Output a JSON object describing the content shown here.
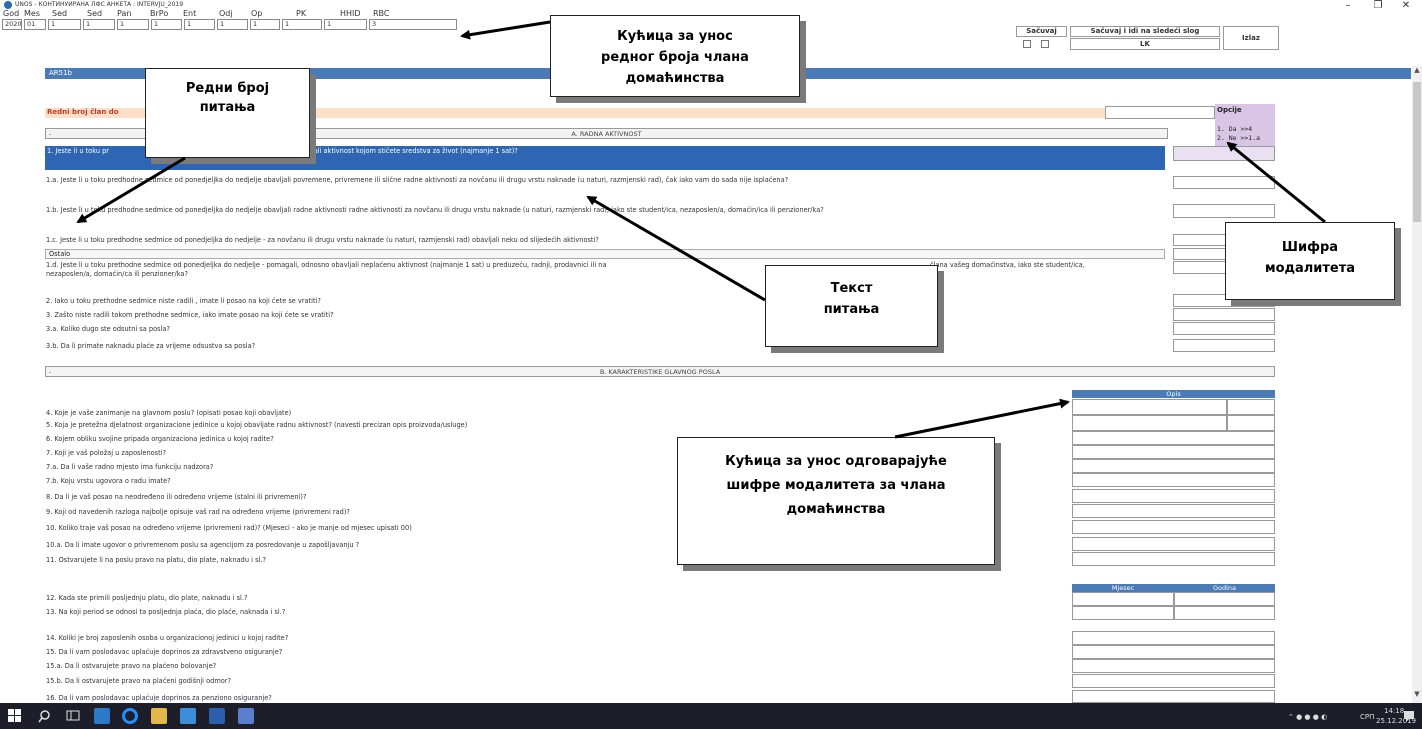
{
  "window": {
    "title": "UNOS - КОНТИНУИРАНА ЛФС АНКЕТА : INTERVJU_2019",
    "minimize": "–",
    "maximize": "❐",
    "close": "✕"
  },
  "header": {
    "labels": [
      "God",
      "Mes",
      "Sed",
      "Sed",
      "Pan",
      "BrPo",
      "Ent",
      "Odj",
      "Op",
      "PK",
      "HHID",
      "RBC"
    ],
    "values": [
      "2020",
      "01",
      "1",
      "1",
      "1",
      "1",
      "1",
      "1",
      "1",
      "1",
      "1",
      "3"
    ],
    "save_label": "Sačuvaj",
    "save_next_label": "Sačuvaj i idi na sledeći slog",
    "lk_label": "LK",
    "exit_label": "Izlaz"
  },
  "form": {
    "module_code": "AR51b",
    "member_row_label": "Redni broj član do",
    "options_title": "Opcije",
    "option_1": "1. Da >>4",
    "option_2": "2. Ne >>1.a",
    "section_a_marker": ".",
    "section_a_title": "A. RADNA AKTIVNOST",
    "q1": "1. Jeste li u toku pr",
    "q1_tail": "dili, obavljali aktivnost kojom stičete sredstva za život (najmanje 1 sat)?",
    "q1a": "1.a. Jeste li u toku predhodne sedmice od ponedjeljka do nedjelje obavljali povremene, privremene ili slične radne aktivnosti za novčanu ili drugu vrstu naknade (u naturi, razmjenski rad), čak iako vam do sada nije isplaćena?",
    "q1b": "1.b. Jeste li u toku predhodne sedmice od ponedjeljka do nedjelje obavljali radne aktivnosti radne aktivnosti za novčanu ili drugu vrstu naknade (u naturi, razmjenski rad), iako ste student/ica, nezaposlen/a, domaćin/ica ili penzioner/ka?",
    "q1c": "1.c. Jeste li u toku predhodne sedmice od ponedjeljka do nedjelje - za novčanu ili drugu vrstu naknade (u naturi, razmjenski rad) obavljali neku od slijedećih aktivnosti?",
    "q1c_value": "Ostalo",
    "q1d": "1.d. Jeste li u toku prethodne sedmice od ponedjeljka do nedjelje - pomagali, odnosno obavljali neplaćenu aktivnost (najmanje 1 sat) u preduzeću, radnji, prodavnici ili na",
    "q1d_tail": "člana vašeg domaćinstva, iako ste student/ica,",
    "q1d_line2": "nezaposlen/a, domaćin/ca ili penzioner/ka?",
    "q2": "2. Iako u toku prethodne sedmice niste radili , imate li posao na koji ćete se vratiti?",
    "q3": "3. Zašto niste radili tokom prethodne sedmice, iako imate posao na koji ćete se vratiti?",
    "q3a": "3.a. Koliko dugo ste odsutni sa posla?",
    "q3b": "3.b. Da li primate naknadu plaće za vrijeme odsustva sa posla?",
    "section_b_marker": ".",
    "section_b_title": "B. KARAKTERISTIKE GLAVNOG POSLA",
    "opis_header": "Opis",
    "q4": "4. Koje je vaše zanimanje na glavnom poslu? (opisati posao koji obavljate)",
    "q5": "5. Koja je pretežna djelatnost organizacione jedinice u kojoj obavljate radnu aktivnost? (navesti precizan opis proizvoda/usluge)",
    "q6": "6. Kojem obliku svojine pripada organizaciona jedinica u kojoj radite?",
    "q7": "7. Koji je vaš položaj u zaposlenosti?",
    "q7a": "7.a. Da li vaše radno mjesto ima funkciju nadzora?",
    "q7b": "7.b. Koju vrstu ugovora o radu imate?",
    "q8": "8. Da li je vaš posao  na neodređeno ili određeno vrijeme (stalni ili privremeni)?",
    "q9": "9. Koji od navedenih razloga najbolje opisuje vaš rad na određeno vrijeme (privremeni rad)?",
    "q10": "10. Koliko traje vaš posao na određeno vrijeme (privremeni rad)? (Mjeseci - ako je manje od mjesec upisati 00)",
    "q10a": "10.a. Da li imate ugovor o privremenom poslu sa agencijom za posredovanje u zapošljavanju ?",
    "q11": "11. Ostvarujete li na poslu pravo na platu, dio plate, naknadu i sl.?",
    "mjesec_header": "Mjesec",
    "godina_header": "Godina",
    "q12": "12. Kada ste primili posljednju platu, dio plate, naknadu i sl.?",
    "q13": "13. Na koji period se odnosi ta posljednja plaća, dio plaće, naknada i sl.?",
    "q14": "14. Koliki je broj zaposlenih osoba u organizacionoj jedinici u kojoj radite?",
    "q15": "15. Da li vam poslodavac uplaćuje doprinos za zdravstveno osiguranje?",
    "q15a": "15.a. Da li ostvarujete pravo na plaćeno bolovanje?",
    "q15b": "15.b. Da li ostvarujete pravo na plaćeni godišnji odmor?",
    "q16": "16. Da li vam poslodavac uplaćuje doprinos za penziono osiguranje?"
  },
  "callouts": {
    "member_box_line1": "Кућица за унос",
    "member_box_line2": "редног броја члана",
    "member_box_line3": "домаћинства",
    "question_no_line1": "Редни број",
    "question_no_line2": "питања",
    "modality_code_line1": "Шифра",
    "modality_code_line2": "модалитета",
    "question_text_line1": "Текст",
    "question_text_line2": "питања",
    "answer_box_line1": "Кућица за унос одговарајуће",
    "answer_box_line2": "шифре модалитета за члана",
    "answer_box_line3": "домаћинства"
  },
  "taskbar": {
    "lang": "СРП",
    "time": "14:18",
    "date": "25.12.2019"
  },
  "colors": {
    "header_band": "#4a7bb7",
    "q1_highlight": "#2f66b3",
    "member_row": "#fde0c6",
    "options_panel": "#d9c6e6",
    "taskbar": "#1e1e2a",
    "callout_shadow": "#7a7a7a"
  }
}
